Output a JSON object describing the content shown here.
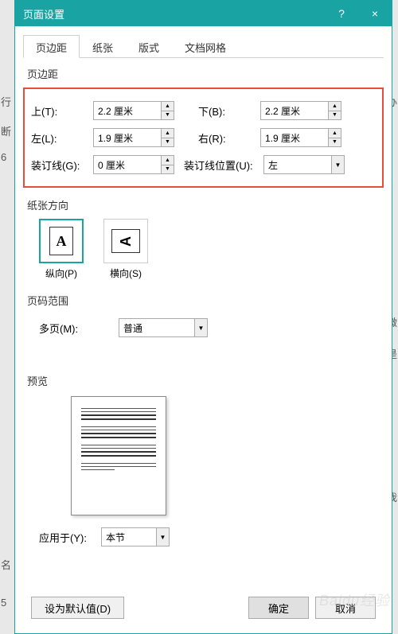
{
  "titlebar": {
    "title": "页面设置",
    "help": "?",
    "close": "×"
  },
  "tabs": {
    "t1": "页边距",
    "t2": "纸张",
    "t3": "版式",
    "t4": "文档网格"
  },
  "sections": {
    "margins": "页边距",
    "orientation": "纸张方向",
    "pages": "页码范围",
    "preview": "预览"
  },
  "margins": {
    "top_label": "上(T):",
    "top_value": "2.2 厘米",
    "bottom_label": "下(B):",
    "bottom_value": "2.2 厘米",
    "left_label": "左(L):",
    "left_value": "1.9 厘米",
    "right_label": "右(R):",
    "right_value": "1.9 厘米",
    "gutter_label": "装订线(G):",
    "gutter_value": "0 厘米",
    "gutter_pos_label": "装订线位置(U):",
    "gutter_pos_value": "左"
  },
  "orientation": {
    "portrait_glyph": "A",
    "portrait_label": "纵向(P)",
    "landscape_glyph": "A",
    "landscape_label": "横向(S)"
  },
  "multipages": {
    "label": "多页(M):",
    "value": "普通"
  },
  "apply_to": {
    "label": "应用于(Y):",
    "value": "本节"
  },
  "buttons": {
    "default": "设为默认值(D)",
    "ok": "确定",
    "cancel": "取消"
  },
  "side": {
    "l1": "行",
    "l2": "断",
    "l3": "6",
    "l4": "名",
    "l5": "5",
    "r1": "办",
    "r2": "微",
    "r3": "是",
    "r4": "我"
  },
  "watermark": "Baidu经验"
}
